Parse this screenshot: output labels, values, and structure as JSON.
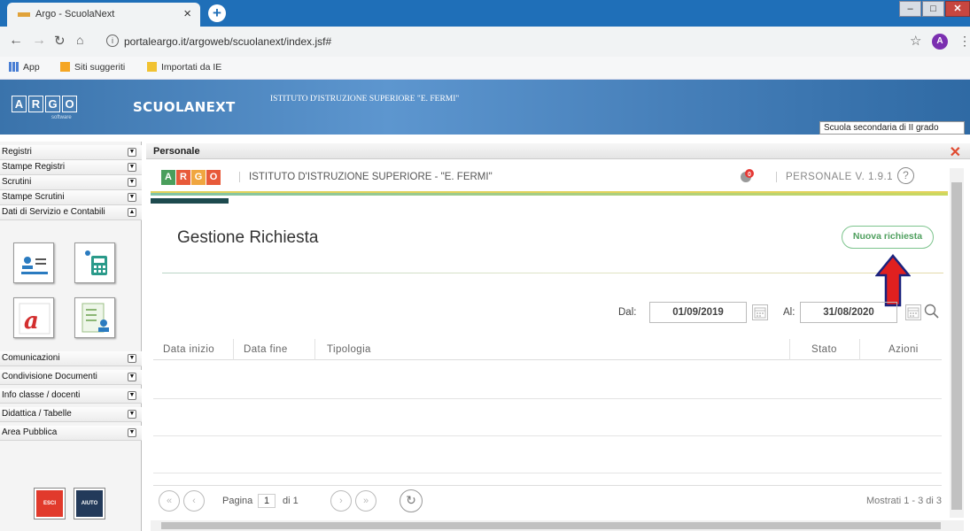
{
  "browser": {
    "tab_title": "Argo - ScuolaNext",
    "url": "portaleargo.it/argoweb/scuolanext/index.jsf#",
    "avatar_letter": "A",
    "bookmarks": [
      "App",
      "Siti suggeriti",
      "Importati da IE"
    ]
  },
  "header": {
    "logo_letters": [
      "A",
      "R",
      "G",
      "O"
    ],
    "logo_sub": "software",
    "brand": "SCUOLANEXT",
    "institute": "ISTITUTO D'ISTRUZIONE SUPERIORE \"E. FERMI\"",
    "school_type": "Scuola secondaria di II grado"
  },
  "sidebar": {
    "items_top": [
      {
        "label": "Registri"
      },
      {
        "label": "Stampe Registri"
      },
      {
        "label": "Scrutini"
      },
      {
        "label": "Stampe Scrutini"
      },
      {
        "label": "Dati di Servizio e Contabili"
      }
    ],
    "items_bottom": [
      {
        "label": "Comunicazioni"
      },
      {
        "label": "Condivisione Documenti"
      },
      {
        "label": "Info classe / docenti"
      },
      {
        "label": "Didattica / Tabelle"
      },
      {
        "label": "Area Pubblica"
      }
    ],
    "esci_label": "ESCI",
    "aiuto_label": "AIUTO"
  },
  "panel": {
    "title": "Personale",
    "app_school": "ISTITUTO D'ISTRUZIONE SUPERIORE - \"E. FERMI\"",
    "app_version": "PERSONALE V. 1.9.1",
    "notif_count": "0",
    "page_title": "Gestione Richiesta",
    "new_request": "Nuova richiesta",
    "dal_label": "Dal:",
    "dal_value": "01/09/2019",
    "al_label": "Al:",
    "al_value": "31/08/2020",
    "columns": [
      "Data inizio",
      "Data fine",
      "Tipologia",
      "Stato",
      "Azioni"
    ],
    "pager": {
      "page_label": "Pagina",
      "page_value": "1",
      "of_label": "di 1",
      "shown": "Mostrati 1 - 3 di 3"
    }
  },
  "colors": {
    "accent_red": "#e02020",
    "green_button": "#7dc48d",
    "header_blue": "#3a73ab"
  }
}
